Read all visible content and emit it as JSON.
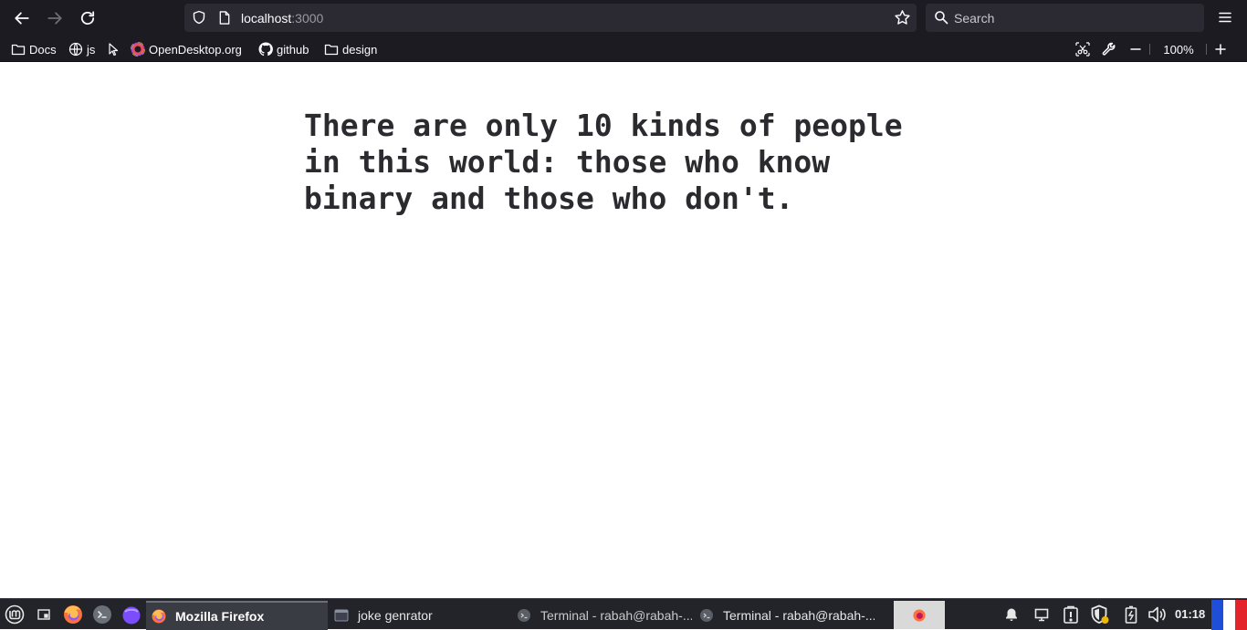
{
  "browser": {
    "url_host": "localhost",
    "url_port": ":3000",
    "search_placeholder": "Search",
    "zoom_level": "100%"
  },
  "bookmarks": [
    {
      "label": "Docs",
      "icon": "folder-icon"
    },
    {
      "label": "js",
      "icon": "globe-icon"
    },
    {
      "label": "",
      "icon": "cursor-icon"
    },
    {
      "label": "OpenDesktop.org",
      "icon": "opendesktop-icon"
    },
    {
      "label": "github",
      "icon": "github-icon"
    },
    {
      "label": "design",
      "icon": "folder-icon"
    }
  ],
  "page": {
    "joke": "There are only 10 kinds of people in this world: those who know binary and those who don't."
  },
  "taskbar": {
    "tasks": [
      {
        "label": "Mozilla Firefox",
        "active": true
      },
      {
        "label": "joke genrator",
        "active": false
      },
      {
        "label": "Terminal - rabah@rabah-...",
        "active": false
      },
      {
        "label": "Terminal - rabah@rabah-...",
        "active": false
      }
    ],
    "clock": "01:18"
  },
  "colors": {
    "toolbar_bg": "#1c1b22",
    "urlbar_bg": "#2b2a33",
    "taskbar_bg": "#23242a",
    "text_light": "#fbfbfe",
    "joke_text": "#2b2a2e"
  }
}
